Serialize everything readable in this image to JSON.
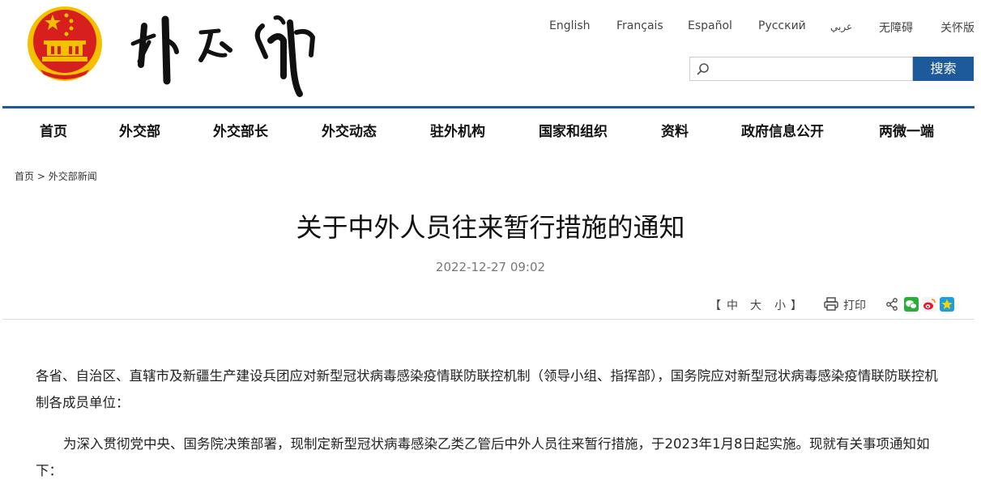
{
  "header": {
    "site_logo_alt": "外交部",
    "languages": [
      "English",
      "Français",
      "Español",
      "Русский",
      "عربي",
      "无障碍",
      "关怀版"
    ],
    "search": {
      "placeholder": "",
      "value": "",
      "button_label": "搜索"
    }
  },
  "nav": {
    "items": [
      "首页",
      "外交部",
      "外交部长",
      "外交动态",
      "驻外机构",
      "国家和组织",
      "资料",
      "政府信息公开",
      "两微一端"
    ]
  },
  "breadcrumb": {
    "home": "首页",
    "sep": " > ",
    "current": "外交部新闻"
  },
  "article": {
    "title": "关于中外人员往来暂行措施的通知",
    "date": "2022-12-27 09:02",
    "font_sizes": {
      "open": "【",
      "medium": "中",
      "large": "大",
      "small": "小",
      "close": "】"
    },
    "print_label": "打印",
    "paragraphs": [
      "各省、自治区、直辖市及新疆生产建设兵团应对新型冠状病毒感染疫情联防联控机制（领导小组、指挥部），国务院应对新型冠状病毒感染疫情联防联控机制各成员单位：",
      "为深入贯彻党中央、国务院决策部署，现制定新型冠状病毒感染乙类乙管后中外人员往来暂行措施，于2023年1月8日起实施。现就有关事项通知如下："
    ]
  },
  "colors": {
    "primary": "#1d5a9c",
    "emblem_red": "#d7201d",
    "emblem_gold": "#f5c000"
  },
  "icons": [
    "national-emblem-icon",
    "search-icon",
    "print-icon",
    "share-icon",
    "wechat-icon",
    "weibo-icon",
    "qzone-icon"
  ]
}
